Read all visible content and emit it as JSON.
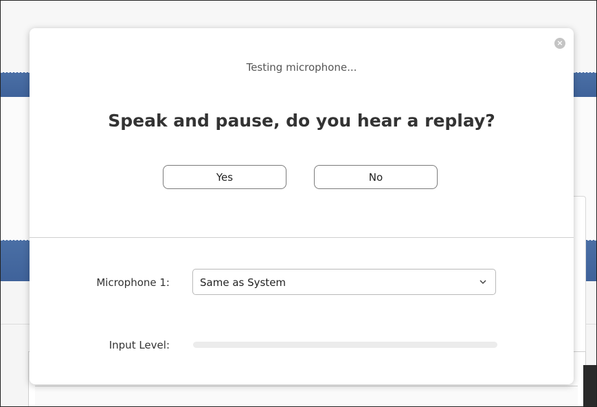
{
  "dialog": {
    "close_label": "×",
    "status": "Testing microphone...",
    "question": "Speak and pause, do you hear a replay?",
    "yes_label": "Yes",
    "no_label": "No"
  },
  "microphone": {
    "label": "Microphone 1:",
    "selected": "Same as System"
  },
  "input_level": {
    "label": "Input Level:",
    "level_percent": 0
  },
  "colors": {
    "background_bar": "#4a6fa5",
    "level_fill": "#2d8cff"
  },
  "icons": {
    "close": "close-icon",
    "dropdown": "chevron-down-icon"
  }
}
